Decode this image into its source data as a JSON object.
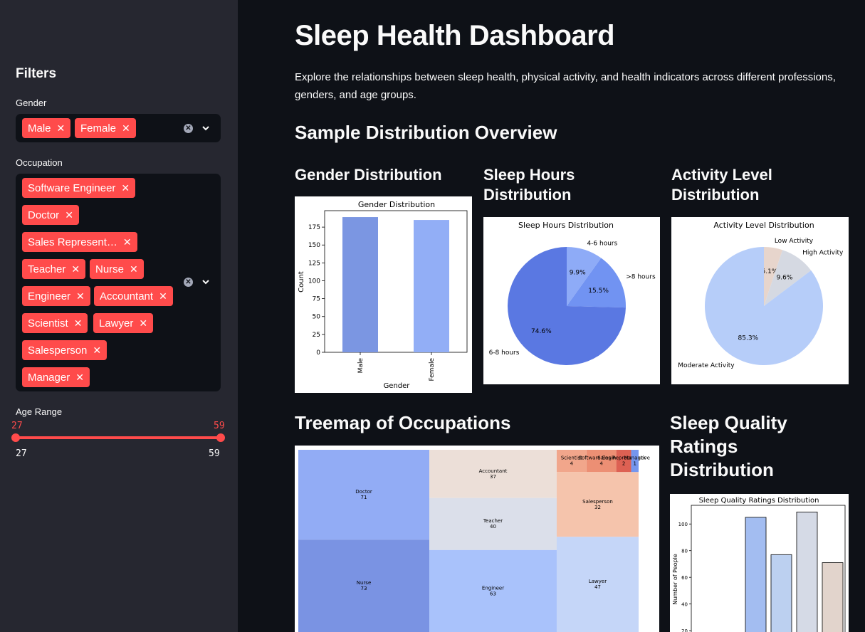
{
  "sidebar": {
    "title": "Filters",
    "gender": {
      "label": "Gender",
      "tags": [
        "Male",
        "Female"
      ]
    },
    "occupation": {
      "label": "Occupation",
      "tags": [
        "Software Engineer",
        "Doctor",
        "Sales Represent…",
        "Teacher",
        "Nurse",
        "Engineer",
        "Accountant",
        "Scientist",
        "Lawyer",
        "Salesperson",
        "Manager"
      ]
    },
    "age": {
      "label": "Age Range",
      "low": "27",
      "high": "59",
      "min": "27",
      "max": "59"
    }
  },
  "main": {
    "title": "Sleep Health Dashboard",
    "intro": "Explore the relationships between sleep health, physical activity, and health indicators across different professions, genders, and age groups.",
    "section_title": "Sample Distribution Overview",
    "gender_heading": "Gender Distribution",
    "sleep_heading": "Sleep Hours Distribution",
    "activity_heading": "Activity Level Distribution",
    "treemap_heading": "Treemap of Occupations",
    "quality_heading": "Sleep Quality Ratings Distribution"
  },
  "colors": {
    "accent": "#ff4b4b",
    "sidebar_bg": "#262730",
    "main_bg": "#0e1117"
  },
  "chart_data": [
    {
      "type": "bar",
      "title": "Gender Distribution",
      "xlabel": "Gender",
      "ylabel": "Count",
      "categories": [
        "Male",
        "Female"
      ],
      "values": [
        189,
        185
      ],
      "ylim": [
        0,
        198
      ],
      "yticks": [
        0,
        25,
        50,
        75,
        100,
        125,
        150,
        175
      ],
      "colors": [
        "#7b96e2",
        "#92aef6"
      ]
    },
    {
      "type": "pie",
      "title": "Sleep Hours Distribution",
      "slices": [
        {
          "label": "4-6 hours",
          "pct": 9.9,
          "pct_label": "9.9%",
          "color": "#8eabf7"
        },
        {
          "label": ">8 hours",
          "pct": 15.5,
          "pct_label": "15.5%",
          "color": "#7193f2"
        },
        {
          "label": "6-8 hours",
          "pct": 74.6,
          "pct_label": "74.6%",
          "color": "#5a78e2"
        }
      ]
    },
    {
      "type": "pie",
      "title": "Activity Level Distribution",
      "slices": [
        {
          "label": "Low Activity",
          "pct": 5.1,
          "pct_label": "5.1%",
          "color": "#e7d5cc"
        },
        {
          "label": "High Activity",
          "pct": 9.6,
          "pct_label": "9.6%",
          "color": "#d5d9e2"
        },
        {
          "label": "Moderate Activity",
          "pct": 85.3,
          "pct_label": "85.3%",
          "color": "#b6cdf9"
        }
      ]
    },
    {
      "type": "treemap",
      "title": "",
      "items": [
        {
          "label": "Doctor",
          "value": 71,
          "color": "#92acf5"
        },
        {
          "label": "Nurse",
          "value": 73,
          "color": "#7a93e3"
        },
        {
          "label": "Accountant",
          "value": 37,
          "color": "#ecdfd8"
        },
        {
          "label": "Teacher",
          "value": 40,
          "color": "#dbdfea"
        },
        {
          "label": "Engineer",
          "value": 63,
          "color": "#a9c2fb"
        },
        {
          "label": "Lawyer",
          "value": 47,
          "color": "#c5d6f8"
        },
        {
          "label": "Salesperson",
          "value": 32,
          "color": "#f5c4ac"
        },
        {
          "label": "Scientist",
          "value": 4,
          "color": "#f1a68b"
        },
        {
          "label": "Software Engineer",
          "value": 4,
          "color": "#ec8f74"
        },
        {
          "label": "Sales Representative",
          "value": 2,
          "color": "#dd6153"
        },
        {
          "label": "Manager",
          "value": 1,
          "color": "#7596ee"
        }
      ]
    },
    {
      "type": "bar",
      "title": "Sleep Quality Ratings Distribution",
      "ylabel": "Number of People",
      "yticks": [
        20,
        40,
        60,
        80,
        100
      ],
      "values": [
        105,
        77,
        109,
        71
      ],
      "colors": [
        "#a3bdf1",
        "#bcd0f0",
        "#d5dae6",
        "#e2d4cc"
      ]
    }
  ]
}
